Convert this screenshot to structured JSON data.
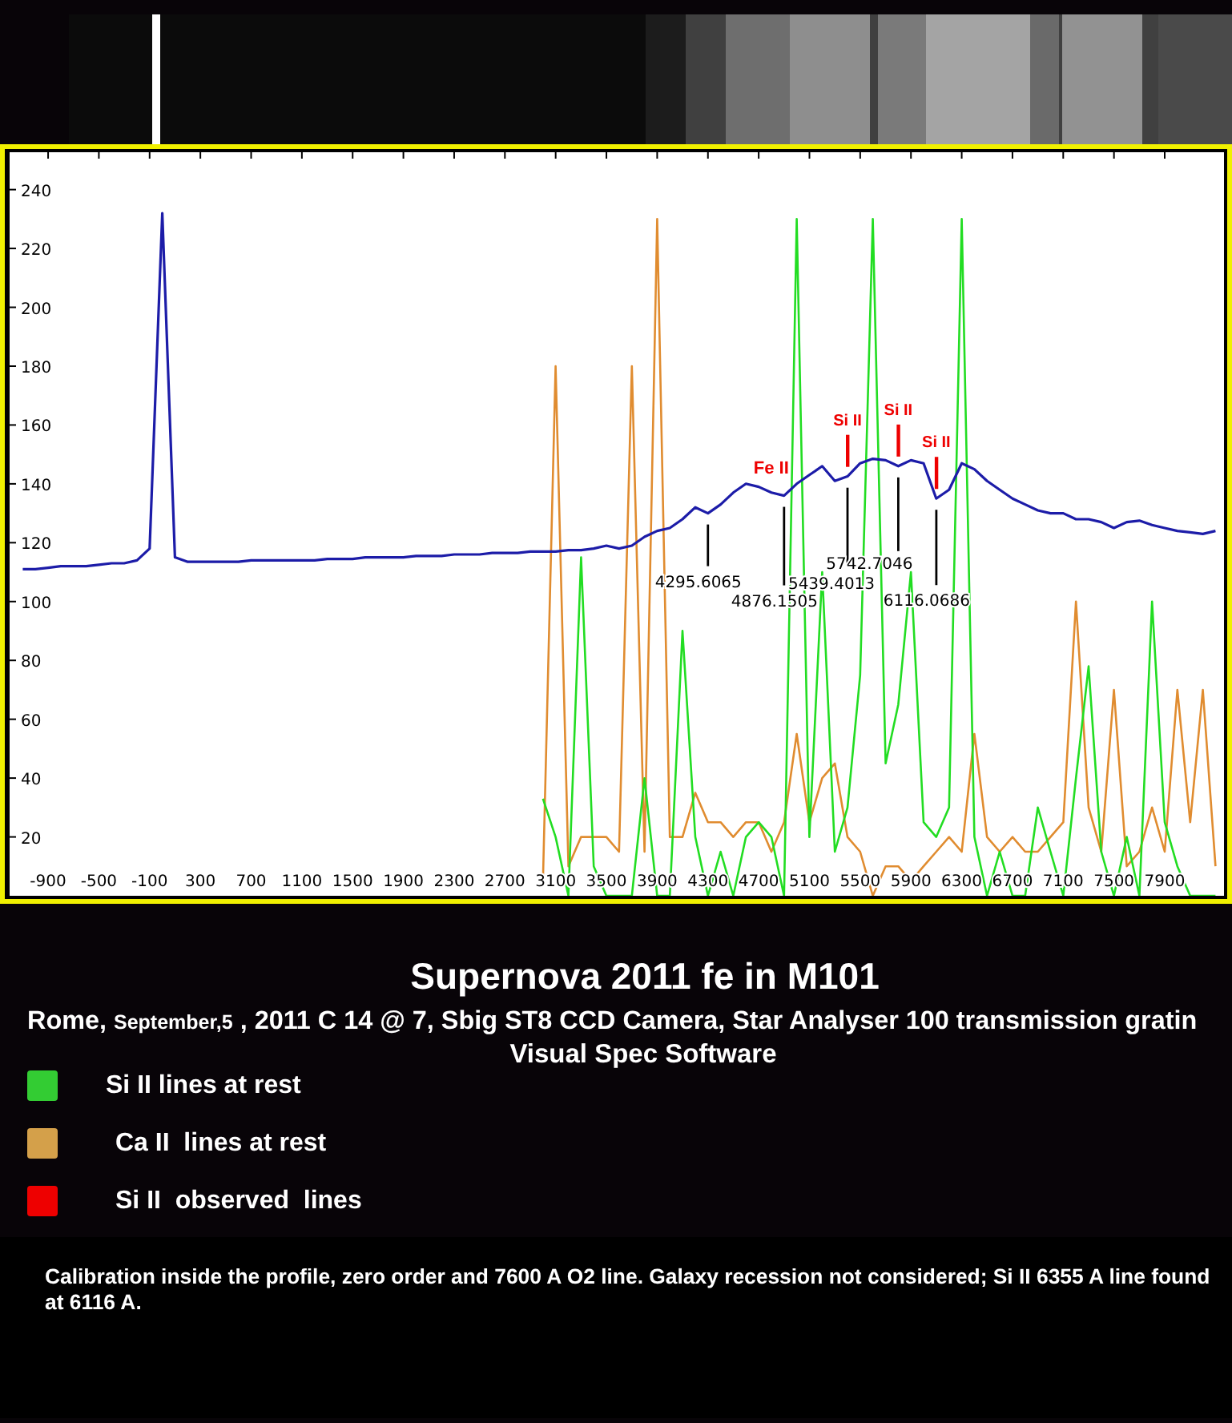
{
  "chart": {
    "chart_data": {
      "type": "line",
      "xlim": [
        -1216,
        8367
      ],
      "ylim": [
        0,
        252.7
      ],
      "xticks": [
        -900,
        -500,
        -100,
        300,
        700,
        1100,
        1500,
        1900,
        2300,
        2700,
        3100,
        3500,
        3900,
        4300,
        4700,
        5100,
        5500,
        5900,
        6300,
        6700,
        7100,
        7500,
        7900
      ],
      "yticks": [
        20,
        40,
        60,
        80,
        100,
        120,
        140,
        160,
        180,
        200,
        220,
        240
      ],
      "x": [
        -1100,
        -1000,
        -900,
        -800,
        -700,
        -600,
        -500,
        -400,
        -300,
        -200,
        -100,
        0,
        100,
        200,
        300,
        400,
        500,
        600,
        700,
        800,
        900,
        1000,
        1100,
        1200,
        1300,
        1400,
        1500,
        1600,
        1700,
        1800,
        1900,
        2000,
        2100,
        2200,
        2300,
        2400,
        2500,
        2600,
        2700,
        2800,
        2900,
        3000,
        3100,
        3200,
        3300,
        3400,
        3500,
        3600,
        3700,
        3800,
        3900,
        4000,
        4100,
        4200,
        4300,
        4400,
        4500,
        4600,
        4700,
        4800,
        4900,
        5000,
        5100,
        5200,
        5300,
        5400,
        5500,
        5600,
        5700,
        5800,
        5900,
        6000,
        6100,
        6200,
        6300,
        6400,
        6500,
        6600,
        6700,
        6800,
        6900,
        7000,
        7100,
        7200,
        7300,
        7400,
        7500,
        7600,
        7700,
        7800,
        7900,
        8000,
        8100,
        8200,
        8300
      ],
      "series": [
        {
          "color": "#e08c30",
          "values": [
            null,
            null,
            null,
            null,
            null,
            null,
            null,
            null,
            null,
            null,
            null,
            null,
            null,
            null,
            null,
            null,
            null,
            null,
            null,
            null,
            null,
            null,
            null,
            null,
            null,
            null,
            null,
            null,
            null,
            null,
            null,
            null,
            null,
            null,
            null,
            null,
            null,
            null,
            null,
            null,
            null,
            5,
            180,
            10,
            20,
            20,
            20,
            15,
            180,
            15,
            230,
            20,
            20,
            35,
            25,
            25,
            20,
            25,
            25,
            15,
            25,
            55,
            25,
            40,
            45,
            20,
            15,
            0,
            10,
            10,
            5,
            10,
            15,
            20,
            15,
            55,
            20,
            15,
            20,
            15,
            15,
            20,
            25,
            100,
            30,
            15,
            70,
            10,
            15,
            30,
            15,
            70,
            25,
            70,
            10
          ]
        },
        {
          "color": "#22dd22",
          "values": [
            null,
            null,
            null,
            null,
            null,
            null,
            null,
            null,
            null,
            null,
            null,
            null,
            null,
            null,
            null,
            null,
            null,
            null,
            null,
            null,
            null,
            null,
            null,
            null,
            null,
            null,
            null,
            null,
            null,
            null,
            null,
            null,
            null,
            null,
            null,
            null,
            null,
            null,
            null,
            null,
            null,
            33,
            20,
            0,
            115,
            10,
            0,
            0,
            0,
            40,
            0,
            0,
            90,
            20,
            0,
            15,
            0,
            20,
            25,
            20,
            0,
            230,
            20,
            110,
            15,
            30,
            75,
            230,
            45,
            65,
            110,
            25,
            20,
            30,
            230,
            20,
            0,
            15,
            0,
            0,
            30,
            15,
            0,
            40,
            78,
            15,
            0,
            20,
            0,
            100,
            25,
            10,
            0,
            0,
            0
          ]
        },
        {
          "color": "#1c1ca8",
          "values": [
            111,
            111,
            111.5,
            112,
            112,
            112,
            112.5,
            113,
            113,
            114,
            118,
            232,
            115,
            113.5,
            113.5,
            113.5,
            113.5,
            113.5,
            114,
            114,
            114,
            114,
            114,
            114,
            114.5,
            114.5,
            114.5,
            115,
            115,
            115,
            115,
            115.5,
            115.5,
            115.5,
            116,
            116,
            116,
            116.5,
            116.5,
            116.5,
            117,
            117,
            117,
            117.5,
            117.5,
            118,
            119,
            118,
            119,
            122,
            124,
            125,
            128,
            132,
            130,
            133,
            137,
            140,
            139,
            137,
            136,
            140,
            143,
            146,
            141,
            142.5,
            147,
            148.5,
            148,
            146,
            148,
            147,
            135,
            138,
            147,
            145,
            141,
            138,
            135,
            133,
            131,
            130,
            130,
            128,
            128,
            127,
            125,
            127,
            127.5,
            126,
            125,
            124,
            123.5,
            123,
            124
          ]
        }
      ],
      "annotations": [
        {
          "x": 4300,
          "y": 130,
          "text": "4295.6065"
        },
        {
          "x": 4900,
          "y": 136,
          "text": "4876.1505"
        },
        {
          "x": 5400,
          "y": 142.5,
          "text": "5439.4013"
        },
        {
          "x": 5800,
          "y": 146,
          "text": "5742.7046"
        },
        {
          "x": 6100,
          "y": 135,
          "text": "6116.0686"
        }
      ]
    },
    "ion_labels": [
      {
        "text": "Fe II",
        "marker": false
      },
      {
        "text": "Si II",
        "marker": true
      },
      {
        "text": "Si II",
        "marker": true
      },
      {
        "text": "Si II",
        "marker": true
      }
    ]
  },
  "caption": {
    "title": "Supernova 2011 fe in M101",
    "subtitle": [
      {
        "kind": "normal",
        "text": "Rome,"
      },
      {
        "kind": "small",
        "text": "September,5"
      },
      {
        "kind": "normal",
        "text": ", 2011 C 14 @ 7,  Sbig ST8 CCD Camera, Star Analyser 100 transmission gratin"
      }
    ],
    "software": "Visual Spec Software"
  },
  "legend": [
    {
      "label": "Si II lines at rest",
      "color": "#33cc33"
    },
    {
      "label": "Ca II  lines at rest",
      "color": "#d4a04a"
    },
    {
      "label": "Si II  observed  lines",
      "color": "#ee0000"
    }
  ],
  "note": "Calibration inside the profile, zero order and 7600 A O2 line. Galaxy recession not considered; Si II 6355 A line found at 6116 A."
}
